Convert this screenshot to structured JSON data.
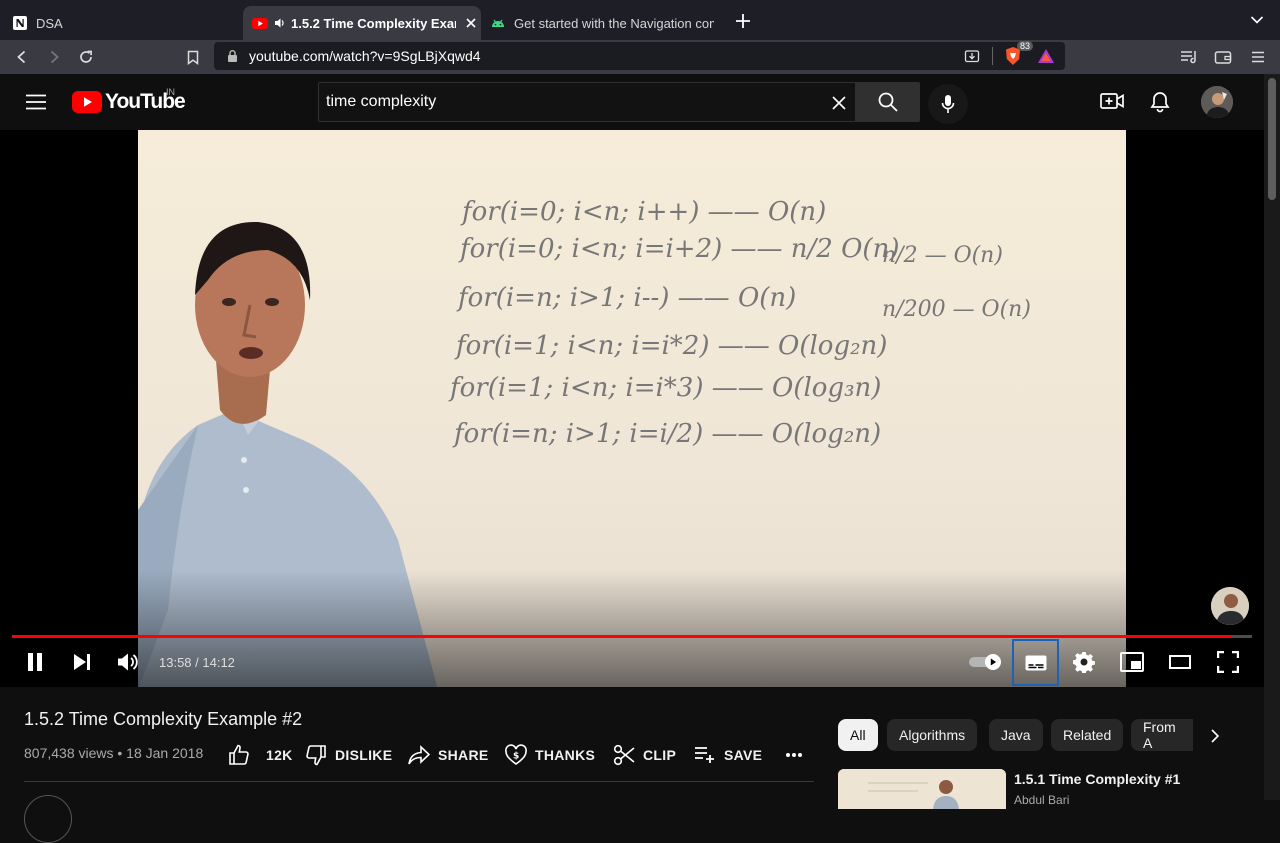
{
  "browser": {
    "tabs": [
      {
        "title": "DSA",
        "favicon": "notion-icon"
      },
      {
        "title": "1.5.2 Time Complexity Examp",
        "favicon": "youtube-icon",
        "playing_audio": true,
        "active": true
      },
      {
        "title": "Get started with the Navigation com",
        "favicon": "android-icon"
      }
    ],
    "url": "youtube.com/watch?v=9SgLBjXqwd4",
    "shield_count": "83"
  },
  "youtube": {
    "logo_text": "YouTube",
    "country_code": "IN",
    "search": {
      "value": "time complexity"
    }
  },
  "player": {
    "board_lines": [
      "for(i=0; i<n; i++) —— O(n)",
      "for(i=0; i<n; i=i+2) —— n/2  O(n)",
      "for(i=n; i>1; i--) —— O(n)",
      "for(i=1; i<n; i=i*2) —— O(log₂n)",
      "for(i=1; i<n; i=i*3) —— O(log₃n)",
      "for(i=n; i>1; i=i/2) —— O(log₂n)"
    ],
    "board_side_notes": [
      "n/2 — O(n)",
      "n/200 — O(n)"
    ],
    "time_current": "13:58",
    "time_total": "14:12",
    "time_display": "13:58 / 14:12",
    "progress_fraction": 0.983,
    "autoplay": true,
    "accent_color": "#ff0000"
  },
  "video": {
    "title": "1.5.2 Time Complexity Example #2",
    "meta": "807,438 views • 18 Jan 2018",
    "actions": {
      "likes": "12K",
      "dislike": "DISLIKE",
      "share": "SHARE",
      "thanks": "THANKS",
      "clip": "CLIP",
      "save": "SAVE"
    }
  },
  "chips": [
    "All",
    "Algorithms",
    "Java",
    "Related",
    "From A"
  ],
  "related": [
    {
      "title": "1.5.1 Time Complexity #1",
      "channel": "Abdul Bari"
    }
  ]
}
